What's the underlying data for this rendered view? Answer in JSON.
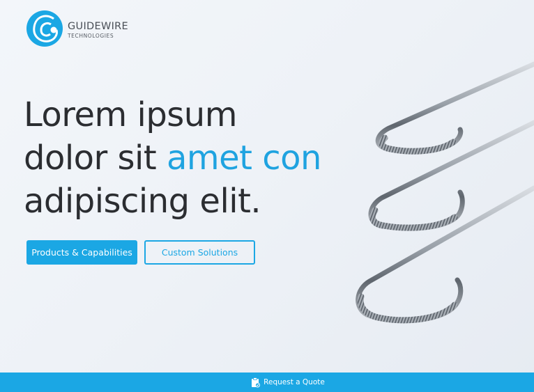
{
  "brand": {
    "name": "GUIDEWIRE",
    "subtitle": "TECHNOLOGIES"
  },
  "hero": {
    "line1": "Lorem ipsum",
    "line2_start": "dolor sit ",
    "line2_accent": "amet con",
    "line3": "adipiscing elit."
  },
  "buttons": {
    "primary_label": "Products & Capabilities",
    "secondary_label": "Custom Solutions"
  },
  "footer": {
    "quote_label": "Request a Quote",
    "icon": "clipboard-check-icon"
  },
  "colors": {
    "accent": "#1ba7e4",
    "text": "#2b2d31",
    "background": "#eef2f7"
  },
  "image": {
    "subject": "guidewire-hooks-icon"
  }
}
